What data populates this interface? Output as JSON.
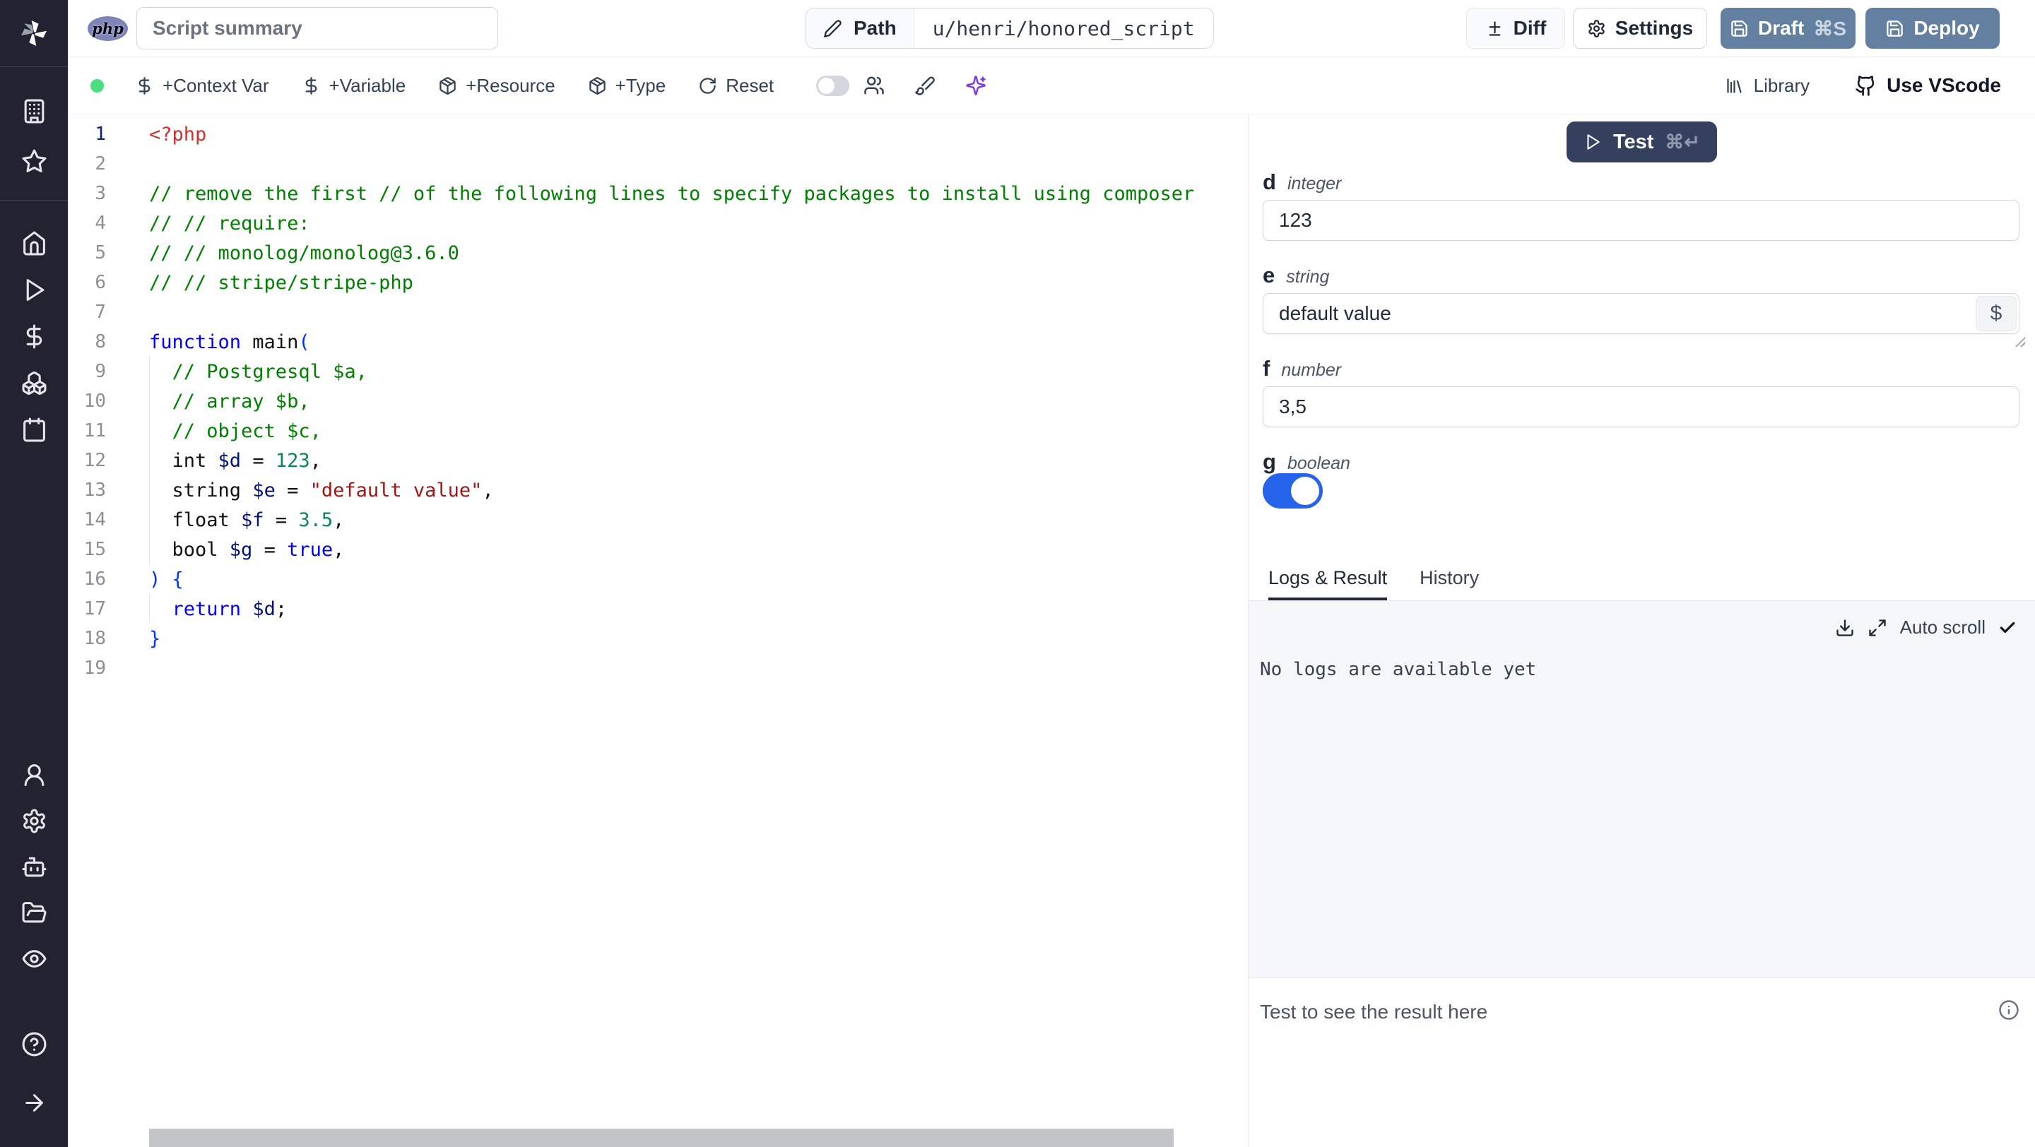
{
  "header": {
    "lang_badge": "php",
    "summary_placeholder": "Script summary",
    "path_label": "Path",
    "path_value": "u/henri/honored_script",
    "diff_label": "Diff",
    "settings_label": "Settings",
    "draft_label": "Draft",
    "draft_shortcut": "⌘S",
    "deploy_label": "Deploy"
  },
  "toolbar": {
    "items": [
      "+Context Var",
      "+Variable",
      "+Resource",
      "+Type",
      "Reset"
    ],
    "library_label": "Library",
    "vscode_label": "Use VScode"
  },
  "editor": {
    "token_colors": {
      "tag": "#cd3131",
      "comment": "#008000",
      "kw": "#0000ff",
      "num": "#098658",
      "str": "#a31515",
      "var": "#001080",
      "br": "#0431fa",
      "def": "#111111"
    },
    "lines": [
      {
        "n": 1,
        "active": true,
        "tokens": [
          [
            "<?php",
            "tag"
          ]
        ]
      },
      {
        "n": 2,
        "tokens": []
      },
      {
        "n": 3,
        "tokens": [
          [
            "// remove the first // of the following lines to specify packages to install using composer",
            "comment"
          ]
        ]
      },
      {
        "n": 4,
        "tokens": [
          [
            "// // require:",
            "comment"
          ]
        ]
      },
      {
        "n": 5,
        "tokens": [
          [
            "// // monolog/monolog@3.6.0",
            "comment"
          ]
        ]
      },
      {
        "n": 6,
        "tokens": [
          [
            "// // stripe/stripe-php",
            "comment"
          ]
        ]
      },
      {
        "n": 7,
        "tokens": []
      },
      {
        "n": 8,
        "tokens": [
          [
            "function",
            "kw"
          ],
          [
            " main",
            "def"
          ],
          [
            "(",
            "br"
          ]
        ]
      },
      {
        "n": 9,
        "guide": true,
        "tokens": [
          [
            "  // Postgresql $a,",
            "comment"
          ]
        ]
      },
      {
        "n": 10,
        "guide": true,
        "tokens": [
          [
            "  // array $b,",
            "comment"
          ]
        ]
      },
      {
        "n": 11,
        "guide": true,
        "tokens": [
          [
            "  // object $c,",
            "comment"
          ]
        ]
      },
      {
        "n": 12,
        "guide": true,
        "tokens": [
          [
            "  int ",
            "def"
          ],
          [
            "$d",
            "var"
          ],
          [
            " = ",
            "def"
          ],
          [
            "123",
            "num"
          ],
          [
            ",",
            "def"
          ]
        ]
      },
      {
        "n": 13,
        "guide": true,
        "tokens": [
          [
            "  string ",
            "def"
          ],
          [
            "$e",
            "var"
          ],
          [
            " = ",
            "def"
          ],
          [
            "\"default value\"",
            "str"
          ],
          [
            ",",
            "def"
          ]
        ]
      },
      {
        "n": 14,
        "guide": true,
        "tokens": [
          [
            "  float ",
            "def"
          ],
          [
            "$f",
            "var"
          ],
          [
            " = ",
            "def"
          ],
          [
            "3.5",
            "num"
          ],
          [
            ",",
            "def"
          ]
        ]
      },
      {
        "n": 15,
        "guide": true,
        "tokens": [
          [
            "  bool ",
            "def"
          ],
          [
            "$g",
            "var"
          ],
          [
            " = ",
            "def"
          ],
          [
            "true",
            "kw"
          ],
          [
            ",",
            "def"
          ]
        ]
      },
      {
        "n": 16,
        "tokens": [
          [
            ") {",
            "br"
          ]
        ]
      },
      {
        "n": 17,
        "guide": true,
        "tokens": [
          [
            "  return",
            "kw"
          ],
          [
            " ",
            "def"
          ],
          [
            "$d",
            "var"
          ],
          [
            ";",
            "def"
          ]
        ]
      },
      {
        "n": 18,
        "tokens": [
          [
            "}",
            "br"
          ]
        ]
      },
      {
        "n": 19,
        "tokens": []
      }
    ]
  },
  "panel": {
    "test_label": "Test",
    "test_shortcut": "⌘↵",
    "fields": [
      {
        "name": "d",
        "type": "integer",
        "value": "123"
      },
      {
        "name": "e",
        "type": "string",
        "value": "default value"
      },
      {
        "name": "f",
        "type": "number",
        "value": "3,5"
      },
      {
        "name": "g",
        "type": "boolean",
        "value": "true"
      }
    ],
    "dollar_button": "$",
    "tabs": [
      "Logs & Result",
      "History"
    ],
    "active_tab": "Logs & Result",
    "autoscroll_label": "Auto scroll",
    "logs_empty": "No logs are available yet",
    "result_placeholder": "Test to see the result here"
  },
  "colors": {
    "sidebar_bg": "#232230",
    "primary_button": "#6480a0",
    "test_button": "#34405e",
    "toggle_on": "#2563eb",
    "status_dot": "#4ade80",
    "ai_accent": "#7c3aed",
    "log_bg": "#f5f6f8"
  }
}
